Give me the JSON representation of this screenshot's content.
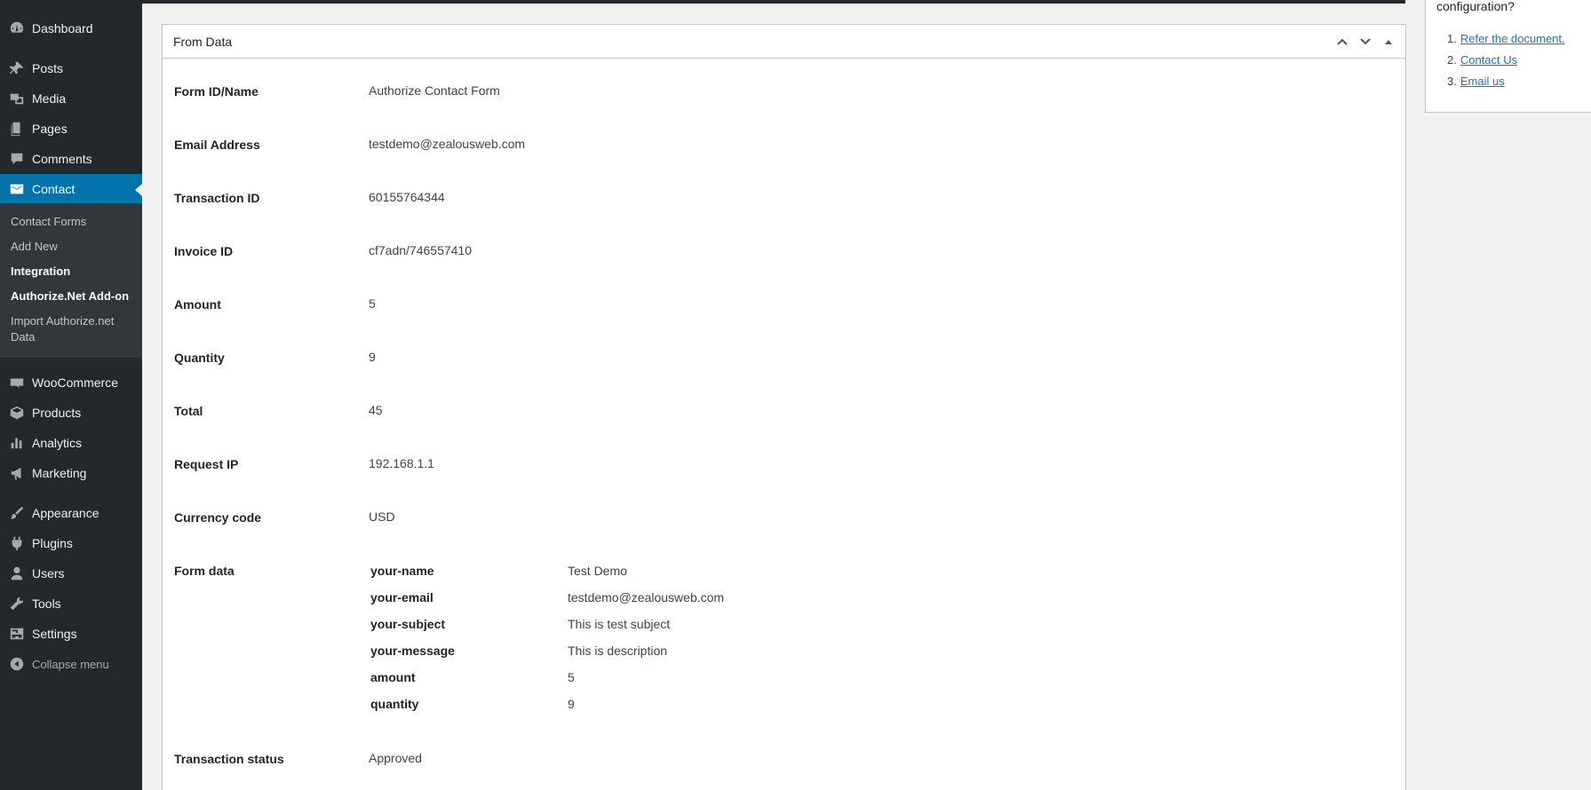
{
  "sidebar": {
    "items": [
      {
        "label": "Dashboard",
        "icon": "dashboard-icon"
      },
      {
        "label": "Posts",
        "icon": "pin-icon"
      },
      {
        "label": "Media",
        "icon": "media-icon"
      },
      {
        "label": "Pages",
        "icon": "pages-icon"
      },
      {
        "label": "Comments",
        "icon": "comments-icon"
      },
      {
        "label": "Contact",
        "icon": "envelope-icon"
      },
      {
        "label": "WooCommerce",
        "icon": "woocommerce-icon"
      },
      {
        "label": "Products",
        "icon": "box-icon"
      },
      {
        "label": "Analytics",
        "icon": "bar-chart-icon"
      },
      {
        "label": "Marketing",
        "icon": "megaphone-icon"
      },
      {
        "label": "Appearance",
        "icon": "brush-icon"
      },
      {
        "label": "Plugins",
        "icon": "plug-icon"
      },
      {
        "label": "Users",
        "icon": "user-icon"
      },
      {
        "label": "Tools",
        "icon": "wrench-icon"
      },
      {
        "label": "Settings",
        "icon": "settings-icon"
      },
      {
        "label": "Collapse menu",
        "icon": "collapse-icon"
      }
    ],
    "submenu": [
      {
        "label": "Contact Forms"
      },
      {
        "label": "Add New"
      },
      {
        "label": "Integration"
      },
      {
        "label": "Authorize.Net Add-on"
      },
      {
        "label": "Import Authorize.net Data"
      }
    ]
  },
  "postbox": {
    "title": "From Data",
    "fields": [
      {
        "label": "Form ID/Name",
        "value": "Authorize Contact Form"
      },
      {
        "label": "Email Address",
        "value": "testdemo@zealousweb.com"
      },
      {
        "label": "Transaction ID",
        "value": "60155764344"
      },
      {
        "label": "Invoice ID",
        "value": "cf7adn/746557410"
      },
      {
        "label": "Amount",
        "value": "5"
      },
      {
        "label": "Quantity",
        "value": "9"
      },
      {
        "label": "Total",
        "value": "45"
      },
      {
        "label": "Request IP",
        "value": "192.168.1.1"
      },
      {
        "label": "Currency code",
        "value": "USD"
      }
    ],
    "form_data_label": "Form data",
    "form_data": [
      {
        "key": "your-name",
        "value": "Test Demo"
      },
      {
        "key": "your-email",
        "value": "testdemo@zealousweb.com"
      },
      {
        "key": "your-subject",
        "value": "This is test subject"
      },
      {
        "key": "your-message",
        "value": "This is description"
      },
      {
        "key": "amount",
        "value": "5"
      },
      {
        "key": "quantity",
        "value": "9"
      }
    ],
    "status_label": "Transaction status",
    "status_value": "Approved"
  },
  "help": {
    "title": "configuration?",
    "links": [
      {
        "num": "1.",
        "label": "Refer the document."
      },
      {
        "num": "2.",
        "label": "Contact Us"
      },
      {
        "num": "3.",
        "label": "Email us"
      }
    ]
  },
  "colors": {
    "sidebar_bg": "#23282d",
    "submenu_bg": "#32373c",
    "accent": "#0073aa",
    "link": "#2271b1"
  }
}
